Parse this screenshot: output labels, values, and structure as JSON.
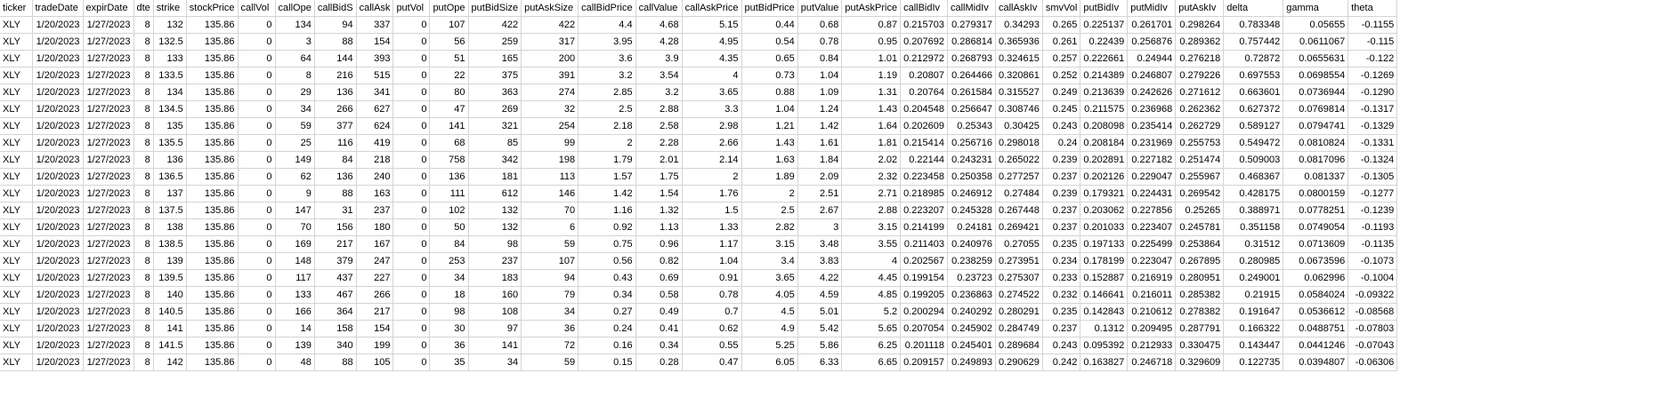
{
  "headers": [
    "ticker",
    "tradeDate",
    "expirDate",
    "dte",
    "strike",
    "stockPrice",
    "callVolume",
    "callOpenInterest",
    "callBidSize",
    "callAskSize",
    "putVolume",
    "putOpenInterest",
    "putBidSize",
    "putAskSize",
    "callBidPrice",
    "callValue",
    "callAskPrice",
    "putBidPrice",
    "putValue",
    "putAskPrice",
    "callBidIv",
    "callMidIv",
    "callAskIv",
    "smvVol",
    "putBidIv",
    "putMidIv",
    "putAskIv",
    "delta",
    "gamma",
    "theta"
  ],
  "header_display": [
    "ticker",
    "tradeDate",
    "expirDate",
    "dte",
    "strike",
    "stockPrice",
    "callVol",
    "callOpe",
    "callBidS",
    "callAsk",
    "putVol",
    "putOpe",
    "putBidSize",
    "putAskSize",
    "callBidPrice",
    "callValue",
    "callAskPrice",
    "putBidPrice",
    "putValue",
    "putAskPrice",
    "callBidIv",
    "callMidIv",
    "callAskIv",
    "smvVol",
    "putBidIv",
    "putMidIv",
    "putAskIv",
    "delta",
    "gamma",
    "theta"
  ],
  "rows": [
    [
      "XLY",
      "1/20/2023",
      "1/27/2023",
      "8",
      "132",
      "135.86",
      "0",
      "134",
      "94",
      "337",
      "0",
      "107",
      "422",
      "422",
      "4.4",
      "4.68",
      "5.15",
      "0.44",
      "0.68",
      "0.87",
      "0.215703",
      "0.279317",
      "0.34293",
      "0.265",
      "0.225137",
      "0.261701",
      "0.298264",
      "0.783348",
      "0.05655",
      "-0.1155"
    ],
    [
      "XLY",
      "1/20/2023",
      "1/27/2023",
      "8",
      "132.5",
      "135.86",
      "0",
      "3",
      "88",
      "154",
      "0",
      "56",
      "259",
      "317",
      "3.95",
      "4.28",
      "4.95",
      "0.54",
      "0.78",
      "0.95",
      "0.207692",
      "0.286814",
      "0.365936",
      "0.261",
      "0.22439",
      "0.256876",
      "0.289362",
      "0.757442",
      "0.0611067",
      "-0.115"
    ],
    [
      "XLY",
      "1/20/2023",
      "1/27/2023",
      "8",
      "133",
      "135.86",
      "0",
      "64",
      "144",
      "393",
      "0",
      "51",
      "165",
      "200",
      "3.6",
      "3.9",
      "4.35",
      "0.65",
      "0.84",
      "1.01",
      "0.212972",
      "0.268793",
      "0.324615",
      "0.257",
      "0.222661",
      "0.24944",
      "0.276218",
      "0.72872",
      "0.0655631",
      "-0.122"
    ],
    [
      "XLY",
      "1/20/2023",
      "1/27/2023",
      "8",
      "133.5",
      "135.86",
      "0",
      "8",
      "216",
      "515",
      "0",
      "22",
      "375",
      "391",
      "3.2",
      "3.54",
      "4",
      "0.73",
      "1.04",
      "1.19",
      "0.20807",
      "0.264466",
      "0.320861",
      "0.252",
      "0.214389",
      "0.246807",
      "0.279226",
      "0.697553",
      "0.0698554",
      "-0.1269"
    ],
    [
      "XLY",
      "1/20/2023",
      "1/27/2023",
      "8",
      "134",
      "135.86",
      "0",
      "29",
      "136",
      "341",
      "0",
      "80",
      "363",
      "274",
      "2.85",
      "3.2",
      "3.65",
      "0.88",
      "1.09",
      "1.31",
      "0.20764",
      "0.261584",
      "0.315527",
      "0.249",
      "0.213639",
      "0.242626",
      "0.271612",
      "0.663601",
      "0.0736944",
      "-0.1290"
    ],
    [
      "XLY",
      "1/20/2023",
      "1/27/2023",
      "8",
      "134.5",
      "135.86",
      "0",
      "34",
      "266",
      "627",
      "0",
      "47",
      "269",
      "32",
      "2.5",
      "2.88",
      "3.3",
      "1.04",
      "1.24",
      "1.43",
      "0.204548",
      "0.256647",
      "0.308746",
      "0.245",
      "0.211575",
      "0.236968",
      "0.262362",
      "0.627372",
      "0.0769814",
      "-0.1317"
    ],
    [
      "XLY",
      "1/20/2023",
      "1/27/2023",
      "8",
      "135",
      "135.86",
      "0",
      "59",
      "377",
      "624",
      "0",
      "141",
      "321",
      "254",
      "2.18",
      "2.58",
      "2.98",
      "1.21",
      "1.42",
      "1.64",
      "0.202609",
      "0.25343",
      "0.30425",
      "0.243",
      "0.208098",
      "0.235414",
      "0.262729",
      "0.589127",
      "0.0794741",
      "-0.1329"
    ],
    [
      "XLY",
      "1/20/2023",
      "1/27/2023",
      "8",
      "135.5",
      "135.86",
      "0",
      "25",
      "116",
      "419",
      "0",
      "68",
      "85",
      "99",
      "2",
      "2.28",
      "2.66",
      "1.43",
      "1.61",
      "1.81",
      "0.215414",
      "0.256716",
      "0.298018",
      "0.24",
      "0.208184",
      "0.231969",
      "0.255753",
      "0.549472",
      "0.0810824",
      "-0.1331"
    ],
    [
      "XLY",
      "1/20/2023",
      "1/27/2023",
      "8",
      "136",
      "135.86",
      "0",
      "149",
      "84",
      "218",
      "0",
      "758",
      "342",
      "198",
      "1.79",
      "2.01",
      "2.14",
      "1.63",
      "1.84",
      "2.02",
      "0.22144",
      "0.243231",
      "0.265022",
      "0.239",
      "0.202891",
      "0.227182",
      "0.251474",
      "0.509003",
      "0.0817096",
      "-0.1324"
    ],
    [
      "XLY",
      "1/20/2023",
      "1/27/2023",
      "8",
      "136.5",
      "135.86",
      "0",
      "62",
      "136",
      "240",
      "0",
      "136",
      "181",
      "113",
      "1.57",
      "1.75",
      "2",
      "1.89",
      "2.09",
      "2.32",
      "0.223458",
      "0.250358",
      "0.277257",
      "0.237",
      "0.202126",
      "0.229047",
      "0.255967",
      "0.468367",
      "0.081337",
      "-0.1305"
    ],
    [
      "XLY",
      "1/20/2023",
      "1/27/2023",
      "8",
      "137",
      "135.86",
      "0",
      "9",
      "88",
      "163",
      "0",
      "111",
      "612",
      "146",
      "1.42",
      "1.54",
      "1.76",
      "2",
      "2.51",
      "2.71",
      "0.218985",
      "0.246912",
      "0.27484",
      "0.239",
      "0.179321",
      "0.224431",
      "0.269542",
      "0.428175",
      "0.0800159",
      "-0.1277"
    ],
    [
      "XLY",
      "1/20/2023",
      "1/27/2023",
      "8",
      "137.5",
      "135.86",
      "0",
      "147",
      "31",
      "237",
      "0",
      "102",
      "132",
      "70",
      "1.16",
      "1.32",
      "1.5",
      "2.5",
      "2.67",
      "2.88",
      "0.223207",
      "0.245328",
      "0.267448",
      "0.237",
      "0.203062",
      "0.227856",
      "0.25265",
      "0.388971",
      "0.0778251",
      "-0.1239"
    ],
    [
      "XLY",
      "1/20/2023",
      "1/27/2023",
      "8",
      "138",
      "135.86",
      "0",
      "70",
      "156",
      "180",
      "0",
      "50",
      "132",
      "6",
      "0.92",
      "1.13",
      "1.33",
      "2.82",
      "3",
      "3.15",
      "0.214199",
      "0.24181",
      "0.269421",
      "0.237",
      "0.201033",
      "0.223407",
      "0.245781",
      "0.351158",
      "0.0749054",
      "-0.1193"
    ],
    [
      "XLY",
      "1/20/2023",
      "1/27/2023",
      "8",
      "138.5",
      "135.86",
      "0",
      "169",
      "217",
      "167",
      "0",
      "84",
      "98",
      "59",
      "0.75",
      "0.96",
      "1.17",
      "3.15",
      "3.48",
      "3.55",
      "0.211403",
      "0.240976",
      "0.27055",
      "0.235",
      "0.197133",
      "0.225499",
      "0.253864",
      "0.31512",
      "0.0713609",
      "-0.1135"
    ],
    [
      "XLY",
      "1/20/2023",
      "1/27/2023",
      "8",
      "139",
      "135.86",
      "0",
      "148",
      "379",
      "247",
      "0",
      "253",
      "237",
      "107",
      "0.56",
      "0.82",
      "1.04",
      "3.4",
      "3.83",
      "4",
      "0.202567",
      "0.238259",
      "0.273951",
      "0.234",
      "0.178199",
      "0.223047",
      "0.267895",
      "0.280985",
      "0.0673596",
      "-0.1073"
    ],
    [
      "XLY",
      "1/20/2023",
      "1/27/2023",
      "8",
      "139.5",
      "135.86",
      "0",
      "117",
      "437",
      "227",
      "0",
      "34",
      "183",
      "94",
      "0.43",
      "0.69",
      "0.91",
      "3.65",
      "4.22",
      "4.45",
      "0.199154",
      "0.23723",
      "0.275307",
      "0.233",
      "0.152887",
      "0.216919",
      "0.280951",
      "0.249001",
      "0.062996",
      "-0.1004"
    ],
    [
      "XLY",
      "1/20/2023",
      "1/27/2023",
      "8",
      "140",
      "135.86",
      "0",
      "133",
      "467",
      "266",
      "0",
      "18",
      "160",
      "79",
      "0.34",
      "0.58",
      "0.78",
      "4.05",
      "4.59",
      "4.85",
      "0.199205",
      "0.236863",
      "0.274522",
      "0.232",
      "0.146641",
      "0.216011",
      "0.285382",
      "0.21915",
      "0.0584024",
      "-0.09322"
    ],
    [
      "XLY",
      "1/20/2023",
      "1/27/2023",
      "8",
      "140.5",
      "135.86",
      "0",
      "166",
      "364",
      "217",
      "0",
      "98",
      "108",
      "34",
      "0.27",
      "0.49",
      "0.7",
      "4.5",
      "5.01",
      "5.2",
      "0.200294",
      "0.240292",
      "0.280291",
      "0.235",
      "0.142843",
      "0.210612",
      "0.278382",
      "0.191647",
      "0.0536612",
      "-0.08568"
    ],
    [
      "XLY",
      "1/20/2023",
      "1/27/2023",
      "8",
      "141",
      "135.86",
      "0",
      "14",
      "158",
      "154",
      "0",
      "30",
      "97",
      "36",
      "0.24",
      "0.41",
      "0.62",
      "4.9",
      "5.42",
      "5.65",
      "0.207054",
      "0.245902",
      "0.284749",
      "0.237",
      "0.1312",
      "0.209495",
      "0.287791",
      "0.166322",
      "0.0488751",
      "-0.07803"
    ],
    [
      "XLY",
      "1/20/2023",
      "1/27/2023",
      "8",
      "141.5",
      "135.86",
      "0",
      "139",
      "340",
      "199",
      "0",
      "36",
      "141",
      "72",
      "0.16",
      "0.34",
      "0.55",
      "5.25",
      "5.86",
      "6.25",
      "0.201118",
      "0.245401",
      "0.289684",
      "0.243",
      "0.095392",
      "0.212933",
      "0.330475",
      "0.143447",
      "0.0441246",
      "-0.07043"
    ],
    [
      "XLY",
      "1/20/2023",
      "1/27/2023",
      "8",
      "142",
      "135.86",
      "0",
      "48",
      "88",
      "105",
      "0",
      "35",
      "34",
      "59",
      "0.15",
      "0.28",
      "0.47",
      "6.05",
      "6.33",
      "6.65",
      "0.209157",
      "0.249893",
      "0.290629",
      "0.242",
      "0.163827",
      "0.246718",
      "0.329609",
      "0.122735",
      "0.0394807",
      "-0.06306"
    ]
  ]
}
